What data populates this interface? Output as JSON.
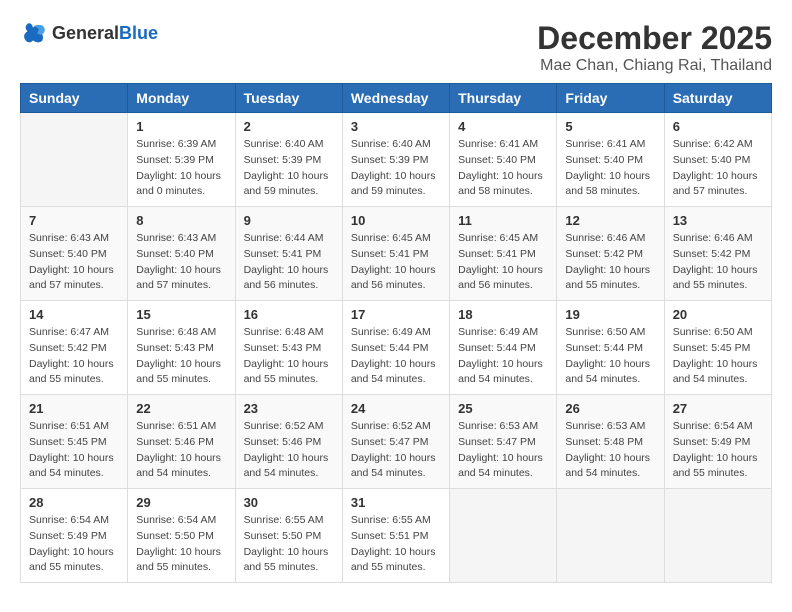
{
  "header": {
    "logo_general": "General",
    "logo_blue": "Blue",
    "month_title": "December 2025",
    "location": "Mae Chan, Chiang Rai, Thailand"
  },
  "weekdays": [
    "Sunday",
    "Monday",
    "Tuesday",
    "Wednesday",
    "Thursday",
    "Friday",
    "Saturday"
  ],
  "weeks": [
    [
      {
        "day": "",
        "sunrise": "",
        "sunset": "",
        "daylight": ""
      },
      {
        "day": "1",
        "sunrise": "Sunrise: 6:39 AM",
        "sunset": "Sunset: 5:39 PM",
        "daylight": "Daylight: 10 hours and 0 minutes."
      },
      {
        "day": "2",
        "sunrise": "Sunrise: 6:40 AM",
        "sunset": "Sunset: 5:39 PM",
        "daylight": "Daylight: 10 hours and 59 minutes."
      },
      {
        "day": "3",
        "sunrise": "Sunrise: 6:40 AM",
        "sunset": "Sunset: 5:39 PM",
        "daylight": "Daylight: 10 hours and 59 minutes."
      },
      {
        "day": "4",
        "sunrise": "Sunrise: 6:41 AM",
        "sunset": "Sunset: 5:40 PM",
        "daylight": "Daylight: 10 hours and 58 minutes."
      },
      {
        "day": "5",
        "sunrise": "Sunrise: 6:41 AM",
        "sunset": "Sunset: 5:40 PM",
        "daylight": "Daylight: 10 hours and 58 minutes."
      },
      {
        "day": "6",
        "sunrise": "Sunrise: 6:42 AM",
        "sunset": "Sunset: 5:40 PM",
        "daylight": "Daylight: 10 hours and 57 minutes."
      }
    ],
    [
      {
        "day": "7",
        "sunrise": "Sunrise: 6:43 AM",
        "sunset": "Sunset: 5:40 PM",
        "daylight": "Daylight: 10 hours and 57 minutes."
      },
      {
        "day": "8",
        "sunrise": "Sunrise: 6:43 AM",
        "sunset": "Sunset: 5:40 PM",
        "daylight": "Daylight: 10 hours and 57 minutes."
      },
      {
        "day": "9",
        "sunrise": "Sunrise: 6:44 AM",
        "sunset": "Sunset: 5:41 PM",
        "daylight": "Daylight: 10 hours and 56 minutes."
      },
      {
        "day": "10",
        "sunrise": "Sunrise: 6:45 AM",
        "sunset": "Sunset: 5:41 PM",
        "daylight": "Daylight: 10 hours and 56 minutes."
      },
      {
        "day": "11",
        "sunrise": "Sunrise: 6:45 AM",
        "sunset": "Sunset: 5:41 PM",
        "daylight": "Daylight: 10 hours and 56 minutes."
      },
      {
        "day": "12",
        "sunrise": "Sunrise: 6:46 AM",
        "sunset": "Sunset: 5:42 PM",
        "daylight": "Daylight: 10 hours and 55 minutes."
      },
      {
        "day": "13",
        "sunrise": "Sunrise: 6:46 AM",
        "sunset": "Sunset: 5:42 PM",
        "daylight": "Daylight: 10 hours and 55 minutes."
      }
    ],
    [
      {
        "day": "14",
        "sunrise": "Sunrise: 6:47 AM",
        "sunset": "Sunset: 5:42 PM",
        "daylight": "Daylight: 10 hours and 55 minutes."
      },
      {
        "day": "15",
        "sunrise": "Sunrise: 6:48 AM",
        "sunset": "Sunset: 5:43 PM",
        "daylight": "Daylight: 10 hours and 55 minutes."
      },
      {
        "day": "16",
        "sunrise": "Sunrise: 6:48 AM",
        "sunset": "Sunset: 5:43 PM",
        "daylight": "Daylight: 10 hours and 55 minutes."
      },
      {
        "day": "17",
        "sunrise": "Sunrise: 6:49 AM",
        "sunset": "Sunset: 5:44 PM",
        "daylight": "Daylight: 10 hours and 54 minutes."
      },
      {
        "day": "18",
        "sunrise": "Sunrise: 6:49 AM",
        "sunset": "Sunset: 5:44 PM",
        "daylight": "Daylight: 10 hours and 54 minutes."
      },
      {
        "day": "19",
        "sunrise": "Sunrise: 6:50 AM",
        "sunset": "Sunset: 5:44 PM",
        "daylight": "Daylight: 10 hours and 54 minutes."
      },
      {
        "day": "20",
        "sunrise": "Sunrise: 6:50 AM",
        "sunset": "Sunset: 5:45 PM",
        "daylight": "Daylight: 10 hours and 54 minutes."
      }
    ],
    [
      {
        "day": "21",
        "sunrise": "Sunrise: 6:51 AM",
        "sunset": "Sunset: 5:45 PM",
        "daylight": "Daylight: 10 hours and 54 minutes."
      },
      {
        "day": "22",
        "sunrise": "Sunrise: 6:51 AM",
        "sunset": "Sunset: 5:46 PM",
        "daylight": "Daylight: 10 hours and 54 minutes."
      },
      {
        "day": "23",
        "sunrise": "Sunrise: 6:52 AM",
        "sunset": "Sunset: 5:46 PM",
        "daylight": "Daylight: 10 hours and 54 minutes."
      },
      {
        "day": "24",
        "sunrise": "Sunrise: 6:52 AM",
        "sunset": "Sunset: 5:47 PM",
        "daylight": "Daylight: 10 hours and 54 minutes."
      },
      {
        "day": "25",
        "sunrise": "Sunrise: 6:53 AM",
        "sunset": "Sunset: 5:47 PM",
        "daylight": "Daylight: 10 hours and 54 minutes."
      },
      {
        "day": "26",
        "sunrise": "Sunrise: 6:53 AM",
        "sunset": "Sunset: 5:48 PM",
        "daylight": "Daylight: 10 hours and 54 minutes."
      },
      {
        "day": "27",
        "sunrise": "Sunrise: 6:54 AM",
        "sunset": "Sunset: 5:49 PM",
        "daylight": "Daylight: 10 hours and 55 minutes."
      }
    ],
    [
      {
        "day": "28",
        "sunrise": "Sunrise: 6:54 AM",
        "sunset": "Sunset: 5:49 PM",
        "daylight": "Daylight: 10 hours and 55 minutes."
      },
      {
        "day": "29",
        "sunrise": "Sunrise: 6:54 AM",
        "sunset": "Sunset: 5:50 PM",
        "daylight": "Daylight: 10 hours and 55 minutes."
      },
      {
        "day": "30",
        "sunrise": "Sunrise: 6:55 AM",
        "sunset": "Sunset: 5:50 PM",
        "daylight": "Daylight: 10 hours and 55 minutes."
      },
      {
        "day": "31",
        "sunrise": "Sunrise: 6:55 AM",
        "sunset": "Sunset: 5:51 PM",
        "daylight": "Daylight: 10 hours and 55 minutes."
      },
      {
        "day": "",
        "sunrise": "",
        "sunset": "",
        "daylight": ""
      },
      {
        "day": "",
        "sunrise": "",
        "sunset": "",
        "daylight": ""
      },
      {
        "day": "",
        "sunrise": "",
        "sunset": "",
        "daylight": ""
      }
    ]
  ]
}
